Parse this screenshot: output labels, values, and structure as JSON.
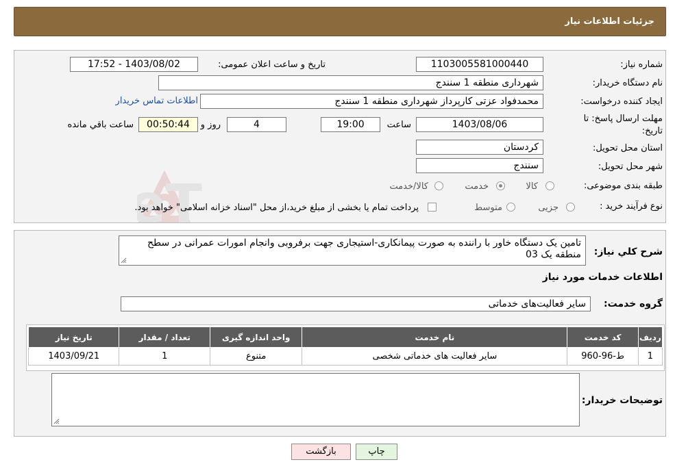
{
  "header": {
    "title": "جزئیات اطلاعات نیاز"
  },
  "form": {
    "need_number_label": "شماره نیاز:",
    "need_number_value": "1103005581000440",
    "announce_label": "تاریخ و ساعت اعلان عمومی:",
    "announce_value": "1403/08/02 - 17:52",
    "buyer_org_label": "نام دستگاه خریدار:",
    "buyer_org_value": "شهرداری منطقه 1 سنندج",
    "creator_label": "ایجاد کننده درخواست:",
    "creator_value": "محمدفواد عزتی کارپرداز شهرداری منطقه 1 سنندج",
    "contact_link": "اطلاعات تماس خریدار",
    "deadline_label_line1": "مهلت ارسال پاسخ: تا",
    "deadline_label_line2": "تاریخ:",
    "deadline_date": "1403/08/06",
    "time_label": "ساعت",
    "deadline_time": "19:00",
    "days_value": "4",
    "days_label": "روز و",
    "remaining_value": "00:50:44",
    "remaining_label": "ساعت باقي مانده",
    "province_label": "استان محل تحویل:",
    "province_value": "کردستان",
    "city_label": "شهر محل تحویل:",
    "city_value": "سنندج",
    "category_label": "طبقه بندی موضوعی:",
    "category_options": [
      "کالا",
      "خدمت",
      "کالا/خدمت"
    ],
    "category_selected": "خدمت",
    "process_label": "نوع فرآیند خرید :",
    "process_options": [
      "جزیی",
      "متوسط"
    ],
    "process_note": "پرداخت تمام یا بخشی از مبلغ خرید،از محل \"اسناد خزانه اسلامی\" خواهد بود."
  },
  "details": {
    "summary_label": "شرح کلي نياز:",
    "summary_value": "تامین یک دستگاه خاور با راننده به صورت پیمانکاری-استیجاری جهت برفروبی وانجام امورات عمرانی در سطح منطقه یک 03",
    "services_title": "اطلاعات خدمات مورد نياز",
    "group_label": "گروه خدمت:",
    "group_value": "سایر فعالیت‌های خدماتی",
    "table": {
      "headers": [
        "ردیف",
        "کد خدمت",
        "نام خدمت",
        "واحد اندازه گیری",
        "تعداد / مقدار",
        "تاریخ نیاز"
      ],
      "rows": [
        [
          "1",
          "ط-96-960",
          "سایر فعالیت های خدماتی شخصی",
          "متنوع",
          "1",
          "1403/09/21"
        ]
      ]
    },
    "buyer_notes_label": "توضیحات خریدار:",
    "buyer_notes_value": ""
  },
  "buttons": {
    "print": "چاپ",
    "back": "بازگشت"
  },
  "colors": {
    "header_bg": "#8b6a3e",
    "table_header_bg": "#5c5c5c",
    "link": "#1a4fa8",
    "back_button_bg": "#fbe3e3",
    "print_button_bg": "#e3f5df",
    "remaining_bg": "#ffffdc"
  }
}
